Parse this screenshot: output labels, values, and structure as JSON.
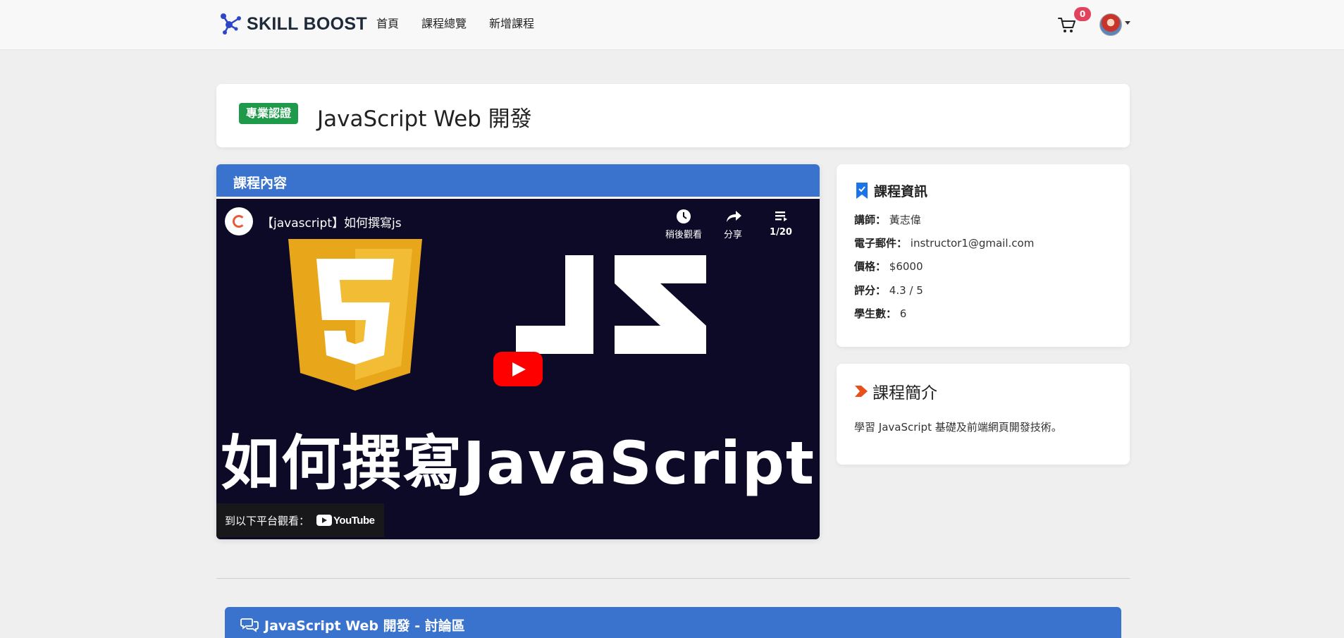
{
  "navbar": {
    "brand": "SKILL BOOST",
    "links": [
      "首頁",
      "課程總覽",
      "新增課程"
    ],
    "cart_count": "0"
  },
  "course": {
    "badge": "專業認證",
    "title": "JavaScript Web 開發"
  },
  "content": {
    "header": "課程內容",
    "video": {
      "title": "【javascript】如何撰寫js",
      "watch_later": "稍後觀看",
      "share": "分享",
      "playlist": "1/20",
      "overlay_text": "如何撰寫JavaScript",
      "watch_on": "到以下平台觀看：",
      "platform": "YouTube"
    }
  },
  "info": {
    "heading": "課程資訊",
    "rows": [
      {
        "label": "講師：",
        "value": "黃志偉"
      },
      {
        "label": "電子郵件：",
        "value": "instructor1@gmail.com"
      },
      {
        "label": "價格：",
        "value": "$6000"
      },
      {
        "label": "評分：",
        "value": "4.3 / 5"
      },
      {
        "label": "學生數：",
        "value": "6"
      }
    ]
  },
  "intro": {
    "heading": "課程簡介",
    "text": "學習 JavaScript 基礎及前端網頁開發技術。"
  },
  "forum": {
    "title": "JavaScript Web 開發 - 討論區"
  },
  "colors": {
    "primary": "#3a73ce",
    "success": "#1e9a4a",
    "badge": "#e0435a",
    "accent": "#e8501a"
  }
}
